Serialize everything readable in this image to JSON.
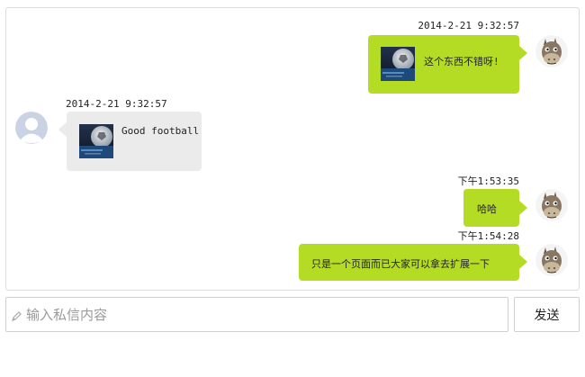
{
  "messages": [
    {
      "side": "right",
      "timestamp": "2014-2-21 9:32:57",
      "text": "这个东西不错呀!",
      "has_image": true,
      "avatar_icon": "donkey-avatar-icon"
    },
    {
      "side": "left",
      "timestamp": "2014-2-21 9:32:57",
      "text": "Good football",
      "has_image": true,
      "avatar_icon": "default-user-avatar-icon"
    },
    {
      "side": "right",
      "timestamp": "下午1:53:35",
      "text": "哈哈",
      "has_image": false,
      "avatar_icon": "donkey-avatar-icon"
    },
    {
      "side": "right",
      "timestamp": "下午1:54:28",
      "text": "只是一个页面而已大家可以拿去扩展一下",
      "has_image": false,
      "avatar_icon": "donkey-avatar-icon"
    }
  ],
  "composer": {
    "placeholder": "输入私信内容",
    "value": "",
    "icon": "pencil-icon",
    "send_label": "发送"
  },
  "colors": {
    "outgoing_bubble": "#b5dc24",
    "incoming_bubble": "#ebebeb",
    "panel_border": "#dcdcdc"
  }
}
